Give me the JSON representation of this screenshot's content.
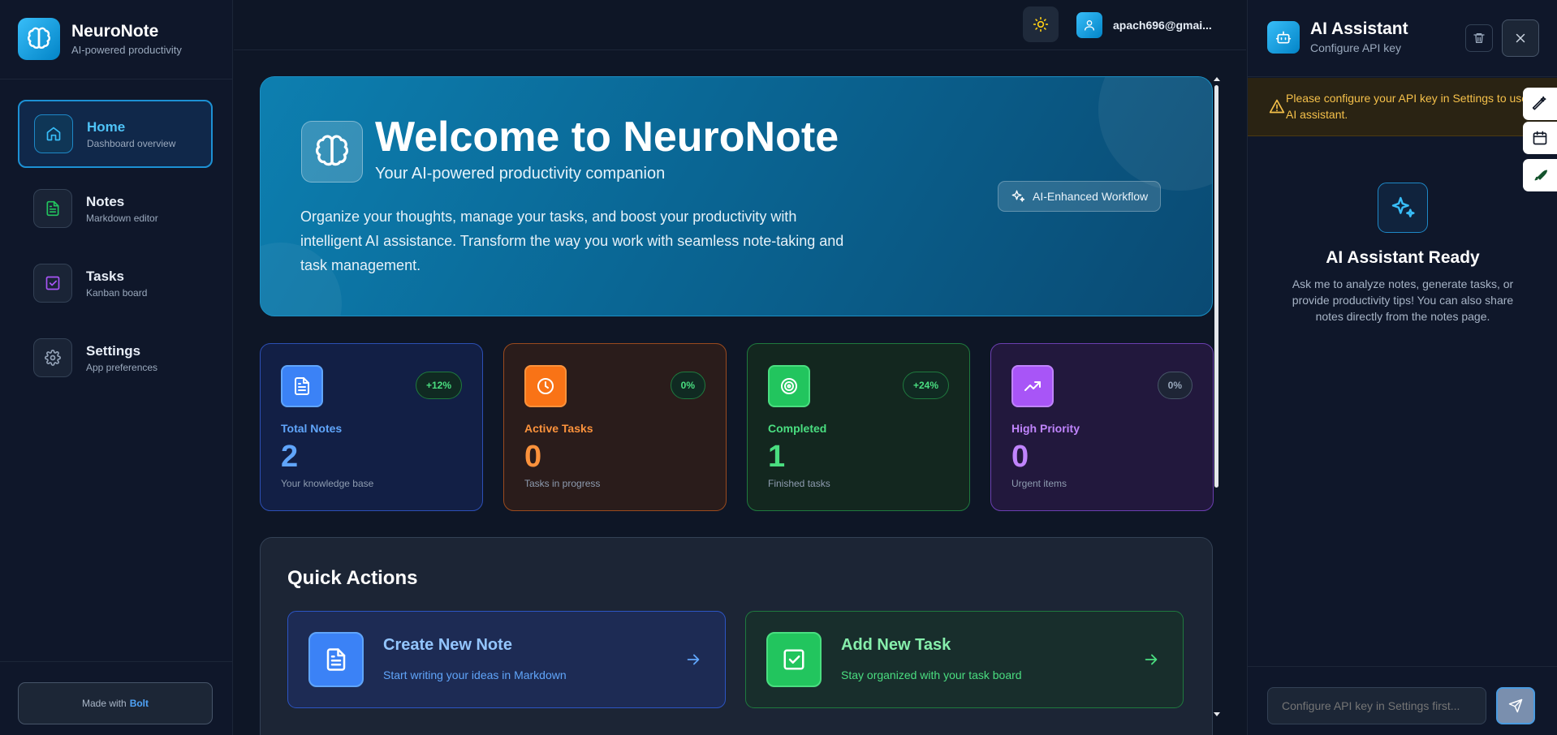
{
  "brand": {
    "title": "NeuroNote",
    "subtitle": "AI-powered productivity"
  },
  "sidebar": {
    "items": [
      {
        "label": "Home",
        "desc": "Dashboard overview",
        "icon": "home-icon",
        "active": true
      },
      {
        "label": "Notes",
        "desc": "Markdown editor",
        "icon": "note-icon",
        "color": "#22c55e"
      },
      {
        "label": "Tasks",
        "desc": "Kanban board",
        "icon": "checkbox-icon",
        "color": "#a855f7"
      },
      {
        "label": "Settings",
        "desc": "App preferences",
        "icon": "gear-icon",
        "color": "#94a3b8"
      }
    ],
    "made_with": "Made with",
    "made_with_brand": "Bolt"
  },
  "topbar": {
    "user_email": "apach696@gmai..."
  },
  "hero": {
    "title": "Welcome to NeuroNote",
    "subtitle": "Your AI-powered productivity companion",
    "badge": "AI-Enhanced Workflow",
    "description": "Organize your thoughts, manage your tasks, and boost your productivity with intelligent AI assistance. Transform the way you work with seamless note-taking and task management."
  },
  "stats": [
    {
      "label": "Total Notes",
      "value": "2",
      "desc": "Your knowledge base",
      "badge": "+12%",
      "color": "#60a5fa",
      "icon": "document-icon"
    },
    {
      "label": "Active Tasks",
      "value": "0",
      "desc": "Tasks in progress",
      "badge": "0%",
      "color": "#fb923c",
      "icon": "clock-icon"
    },
    {
      "label": "Completed",
      "value": "1",
      "desc": "Finished tasks",
      "badge": "+24%",
      "color": "#4ade80",
      "icon": "target-icon"
    },
    {
      "label": "High Priority",
      "value": "0",
      "desc": "Urgent items",
      "badge": "0%",
      "color": "#c084fc",
      "icon": "trending-up-icon"
    }
  ],
  "quick_actions": {
    "title": "Quick Actions",
    "items": [
      {
        "name": "Create New Note",
        "desc": "Start writing your ideas in Markdown",
        "icon": "document-icon",
        "color": "#60a5fa"
      },
      {
        "name": "Add New Task",
        "desc": "Stay organized with your task board",
        "icon": "checkbox-icon",
        "color": "#4ade80"
      }
    ]
  },
  "ai_panel": {
    "title": "AI Assistant",
    "subtitle": "Configure API key",
    "warning": "Please configure your API key in Settings to use the AI assistant.",
    "ready_title": "AI Assistant Ready",
    "ready_desc": "Ask me to analyze notes, generate tasks, or provide productivity tips! You can also share notes directly from the notes page.",
    "input_placeholder": "Configure API key in Settings first..."
  }
}
